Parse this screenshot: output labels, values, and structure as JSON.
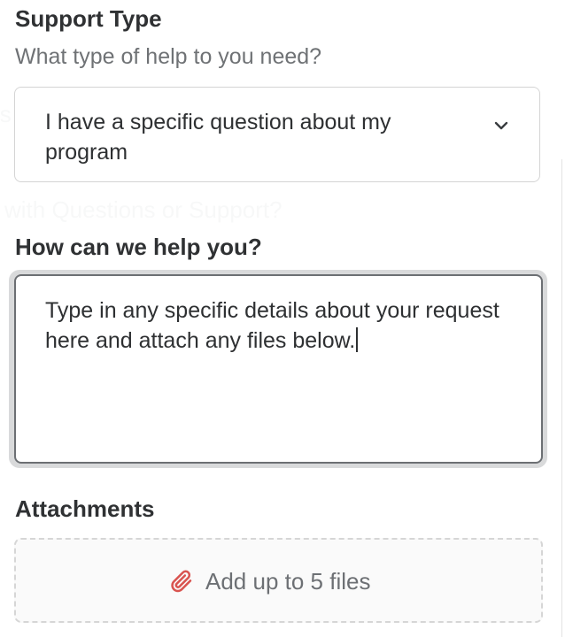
{
  "support_type": {
    "label": "Support Type",
    "hint": "What type of help to you need?",
    "selected": "I have a specific question about my program",
    "chevron_icon": "chevron-down-icon"
  },
  "help": {
    "label": "How can we help you?",
    "value": "Type in any specific details about your request here and attach any files below."
  },
  "attachments": {
    "label": "Attachments",
    "action_label": "Add up to 5 files",
    "icon": "paperclip-icon",
    "icon_color": "#d9534f"
  },
  "background": {
    "faded_text_1": "is",
    "faded_text_2": "l with Questions or Support?"
  }
}
